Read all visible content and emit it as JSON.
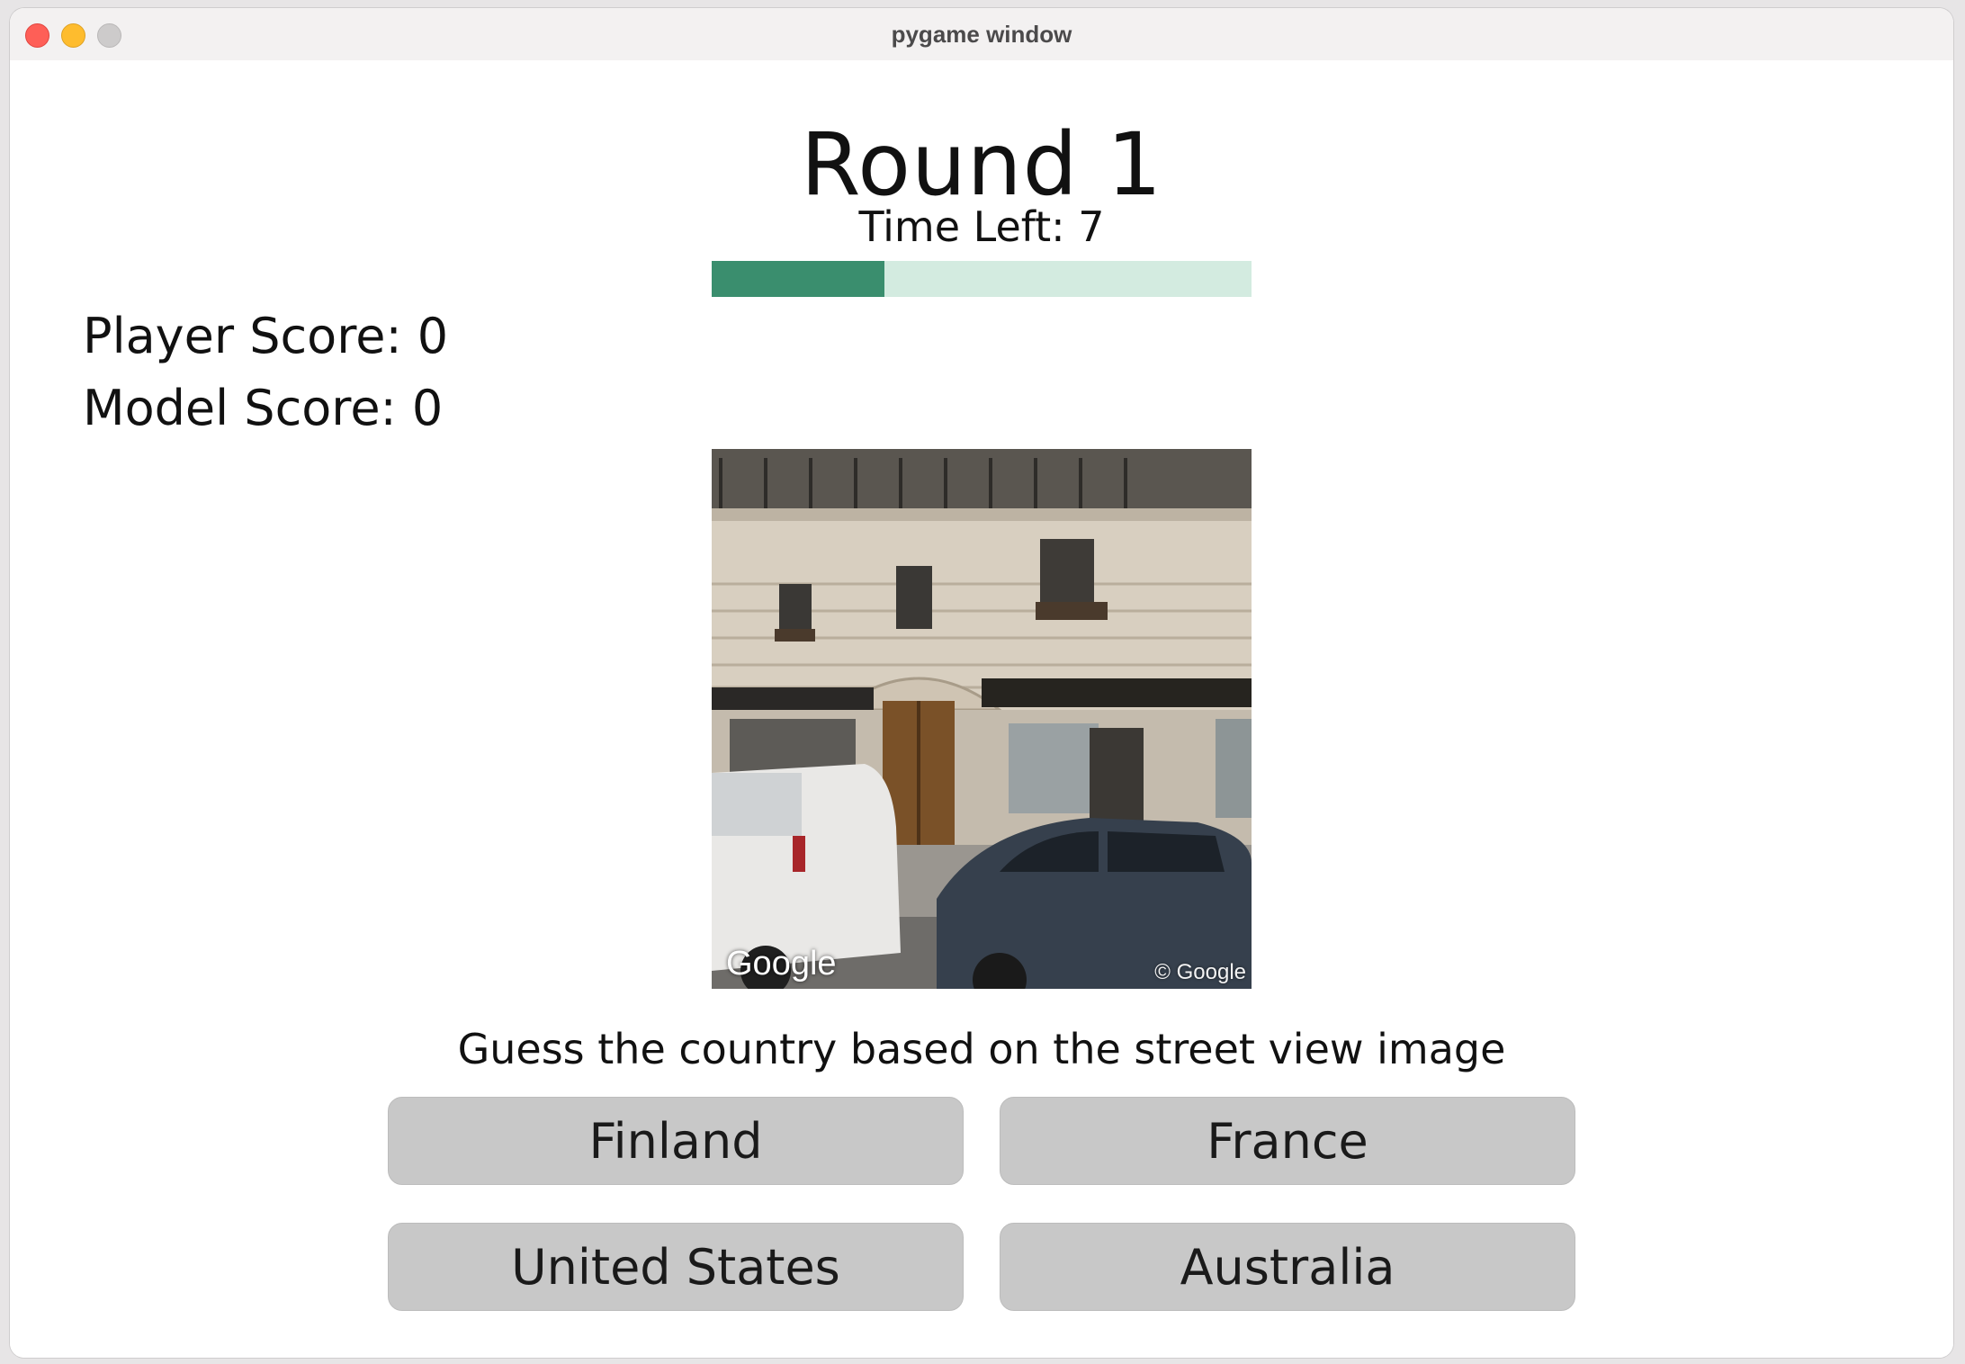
{
  "window": {
    "title": "pygame window"
  },
  "game": {
    "round_title": "Round 1",
    "time_left_text": "Time Left: 7",
    "time_progress_fraction": 0.32,
    "player_score_text": "Player Score: 0",
    "model_score_text": "Model Score: 0",
    "prompt": "Guess the country based on the street view image",
    "options": [
      "Finland",
      "France",
      "United States",
      "Australia"
    ]
  },
  "street_view": {
    "logo_text": "Google",
    "copyright_text": "© Google"
  },
  "colors": {
    "progress_fill": "#3a8e6e",
    "progress_track": "#d3ebe0",
    "button_bg": "#c8c8c8"
  }
}
